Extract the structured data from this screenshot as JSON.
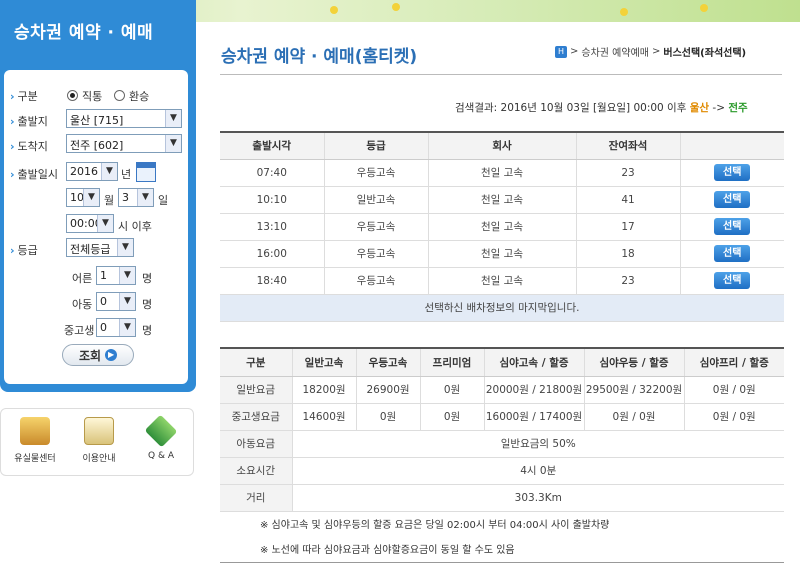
{
  "sidebar": {
    "title": "승차권 예약 · 예매",
    "gubun_label": "구분",
    "gubun_options": [
      "직통",
      "환승"
    ],
    "depart_label": "출발지",
    "depart_value": "울산 [715]",
    "arrive_label": "도착지",
    "arrive_value": "전주 [602]",
    "date_label": "출발일시",
    "year": "2016",
    "year_unit": "년",
    "month": "10",
    "month_unit": "월",
    "day": "3",
    "day_unit": "일",
    "time": "00:00",
    "time_suffix": "시 이후",
    "grade_label": "등급",
    "grade_value": "전체등급",
    "adult_label": "어른",
    "adult_value": "1",
    "child_label": "아동",
    "child_value": "0",
    "student_label": "중고생",
    "student_value": "0",
    "person_unit": "명",
    "search_label": "조회"
  },
  "quicklinks": [
    {
      "label": "유실물센터",
      "icon": "lost-found-icon"
    },
    {
      "label": "이용안내",
      "icon": "guide-icon"
    },
    {
      "label": "Q & A",
      "icon": "qna-icon"
    }
  ],
  "page": {
    "title": "승차권 예약 · 예매(홈티켓)",
    "breadcrumb": [
      "승차권 예약예매",
      "버스선택(좌석선택)"
    ],
    "breadcrumb_sep": ">",
    "result_prefix": "검색결과: 2016년 10월 03일 [월요일] 00:00 이후",
    "result_from": "울산",
    "result_arrow": "->",
    "result_to": "전주"
  },
  "schedule": {
    "headers": [
      "출발시각",
      "등급",
      "회사",
      "잔여좌석",
      ""
    ],
    "select_label": "선택",
    "rows": [
      {
        "time": "07:40",
        "grade": "우등고속",
        "company": "천일 고속",
        "seats": "23"
      },
      {
        "time": "10:10",
        "grade": "일반고속",
        "company": "천일 고속",
        "seats": "41"
      },
      {
        "time": "13:10",
        "grade": "우등고속",
        "company": "천일 고속",
        "seats": "17"
      },
      {
        "time": "16:00",
        "grade": "우등고속",
        "company": "천일 고속",
        "seats": "18"
      },
      {
        "time": "18:40",
        "grade": "우등고속",
        "company": "천일 고속",
        "seats": "23"
      }
    ],
    "last_notice": "선택하신 배차정보의 마지막입니다."
  },
  "fares": {
    "headers": [
      "구분",
      "일반고속",
      "우등고속",
      "프리미엄",
      "심야고속 / 할증",
      "심야우등 / 할증",
      "심야프리 / 할증"
    ],
    "rows": [
      {
        "kind": "일반요금",
        "values": [
          "18200원",
          "26900원",
          "0원",
          "20000원 / 21800원",
          "29500원 / 32200원",
          "0원 / 0원"
        ]
      },
      {
        "kind": "중고생요금",
        "values": [
          "14600원",
          "0원",
          "0원",
          "16000원 / 17400원",
          "0원 / 0원",
          "0원 / 0원"
        ]
      }
    ],
    "child_label": "아동요금",
    "child_value": "일반요금의 50%",
    "duration_label": "소요시간",
    "duration_value": "4시 0분",
    "distance_label": "거리",
    "distance_value": "303.3Km"
  },
  "notes": [
    "※ 심야고속 및 심야우등의 할증 요금은 당일 02:00시 부터 04:00시 사이 출발차량",
    "※ 노선에 따라 심야요금과 심야할증요금이 동일 할 수도 있음"
  ]
}
